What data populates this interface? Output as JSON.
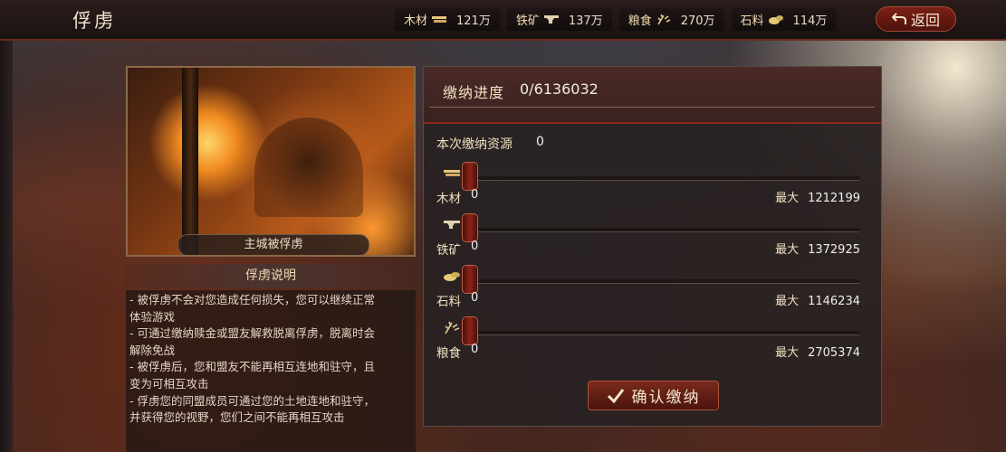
{
  "header": {
    "title": "俘虏",
    "back_label": "返回",
    "resources": [
      {
        "label": "木材",
        "icon": "wood-icon",
        "value": "121万"
      },
      {
        "label": "铁矿",
        "icon": "iron-icon",
        "value": "137万"
      },
      {
        "label": "粮食",
        "icon": "grain-icon",
        "value": "270万"
      },
      {
        "label": "石料",
        "icon": "stone-icon",
        "value": "114万"
      }
    ]
  },
  "left": {
    "image_caption": "主城被俘虏",
    "explain_title": "俘虏说明",
    "explain_lines": [
      "- 被俘虏不会对您造成任何损失，您可以继续正常",
      "体验游戏",
      "- 可通过缴纳赎金或盟友解救脱离俘虏，脱离时会",
      "解除免战",
      "- 被俘虏后，您和盟友不能再相互连地和驻守，且",
      "变为可相互攻击",
      "- 俘虏您的同盟成员可通过您的土地连地和驻守，",
      "并获得您的视野，您们之间不能再相互攻击"
    ]
  },
  "right": {
    "progress_label": "缴纳进度",
    "progress_value": "0/6136032",
    "contribution_label": "本次缴纳资源",
    "contribution_value": "0",
    "max_label": "最大",
    "rows": [
      {
        "label": "木材",
        "icon": "wood-icon",
        "value": "0",
        "max": "1212199",
        "fraction": 0
      },
      {
        "label": "铁矿",
        "icon": "iron-icon",
        "value": "0",
        "max": "1372925",
        "fraction": 0
      },
      {
        "label": "石料",
        "icon": "stone-icon",
        "value": "0",
        "max": "1146234",
        "fraction": 0
      },
      {
        "label": "粮食",
        "icon": "grain-icon",
        "value": "0",
        "max": "2705374",
        "fraction": 0
      }
    ],
    "confirm_label": "确认缴纳"
  },
  "colors": {
    "accent_red": "#8a2a1e",
    "gold_text": "#f0dfc0",
    "panel_bg": "#282222"
  }
}
